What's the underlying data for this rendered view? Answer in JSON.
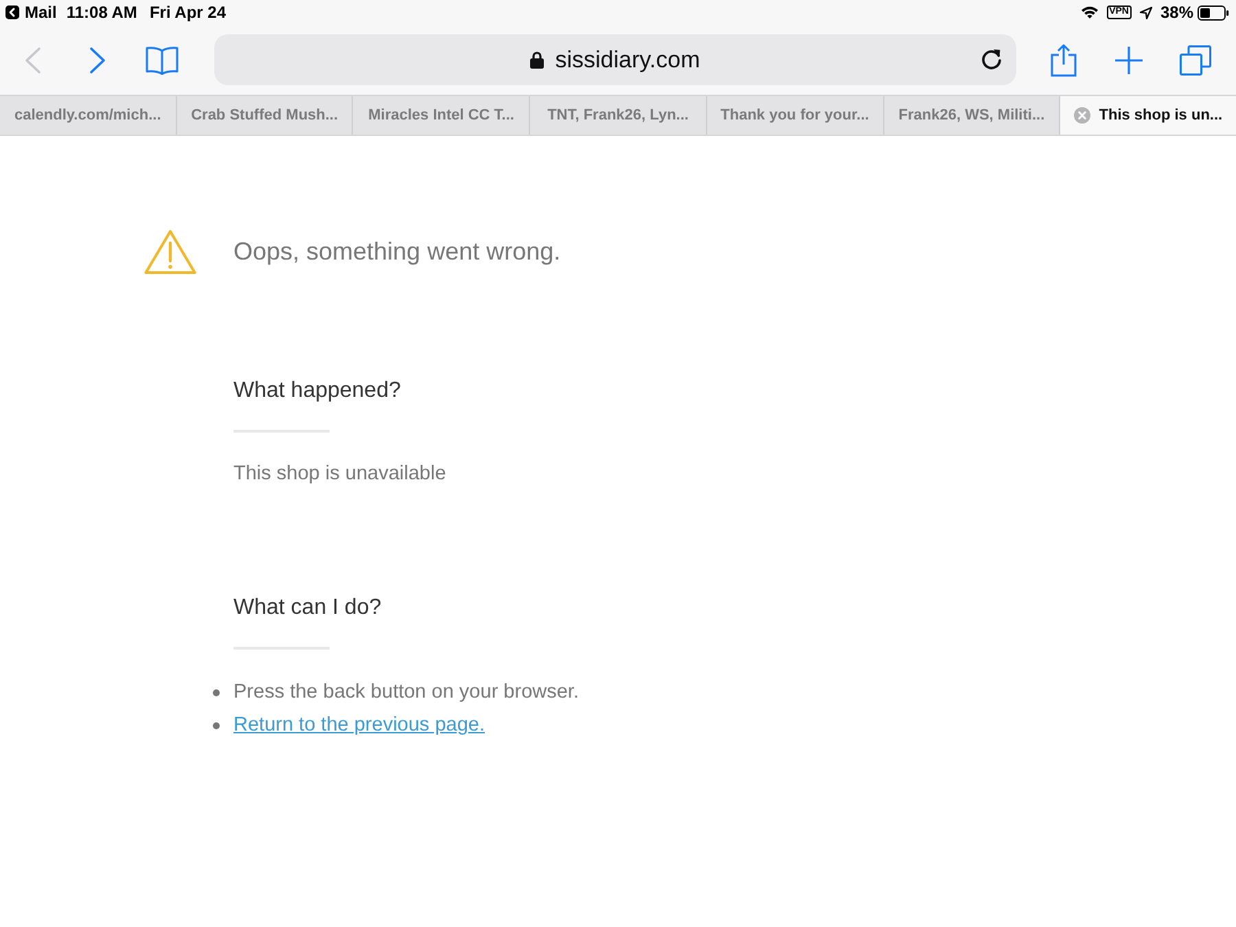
{
  "status_bar": {
    "back_app": "Mail",
    "time": "11:08 AM",
    "date": "Fri Apr 24",
    "vpn": "VPN",
    "battery": "38%"
  },
  "toolbar": {
    "nav": [
      {
        "kind": "back",
        "disabled": true
      },
      {
        "kind": "forward",
        "disabled": false
      }
    ],
    "address": {
      "secure": true,
      "url": "sissidiary.com"
    }
  },
  "tabs": [
    {
      "title": "calendly.com/mich...",
      "selected": false
    },
    {
      "title": "Crab Stuffed Mush...",
      "selected": false
    },
    {
      "title": "Miracles Intel CC T...",
      "selected": false
    },
    {
      "title": "TNT, Frank26, Lyn...",
      "selected": false
    },
    {
      "title": "Thank you for your...",
      "selected": false
    },
    {
      "title": "Frank26, WS, Militi...",
      "selected": false
    },
    {
      "title": "This shop is un...",
      "selected": true
    }
  ],
  "error": {
    "title": "Oops, something went wrong.",
    "sections": [
      {
        "heading": "What happened?",
        "text": "This shop is unavailable"
      },
      {
        "heading": "What can I do?",
        "items": [
          {
            "kind": "text",
            "text": "Press the back button on your browser."
          },
          {
            "kind": "link",
            "text": "Return to the previous page."
          }
        ]
      }
    ]
  }
}
